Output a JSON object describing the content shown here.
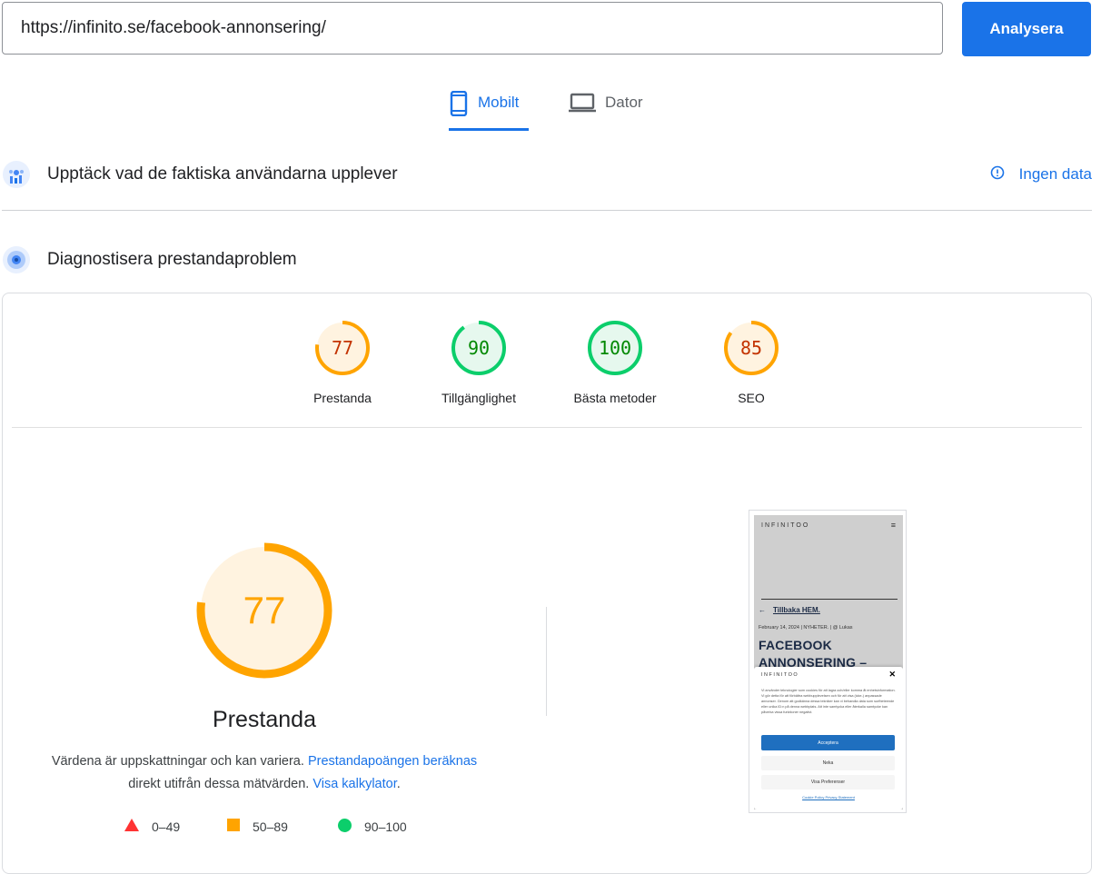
{
  "search": {
    "url": "https://infinito.se/facebook-annonsering/",
    "button_label": "Analysera"
  },
  "tabs": [
    {
      "label": "Mobilt",
      "icon": "smartphone-icon",
      "active": true
    },
    {
      "label": "Dator",
      "icon": "laptop-icon",
      "active": false
    }
  ],
  "field_data": {
    "title": "Upptäck vad de faktiska användarna upplever",
    "status": "Ingen data"
  },
  "lab": {
    "title": "Diagnostisera prestandaproblem"
  },
  "scores": [
    {
      "label": "Prestanda",
      "value": 77,
      "category": "average"
    },
    {
      "label": "Tillgänglighet",
      "value": 90,
      "category": "pass"
    },
    {
      "label": "Bästa metoder",
      "value": 100,
      "category": "pass"
    },
    {
      "label": "SEO",
      "value": 85,
      "category": "average"
    }
  ],
  "main_score": {
    "value": 77,
    "title": "Prestanda",
    "desc_1": "Värdena är uppskattningar och kan variera.",
    "link_1": "Prestandapoängen beräknas",
    "desc_2": "direkt utifrån dessa mätvärden.",
    "link_2": "Visa kalkylator",
    "desc_end": "."
  },
  "legend": [
    {
      "range": "0–49",
      "color": "#ff3333"
    },
    {
      "range": "50–89",
      "color": "#ffa400"
    },
    {
      "range": "90–100",
      "color": "#0cce6b"
    }
  ],
  "colors": {
    "accent": "#1a73e8",
    "average_stroke": "#ffa400",
    "average_fill": "#fff3e0",
    "average_text": "#c33300",
    "pass_stroke": "#0cce6b",
    "pass_fill": "#e6f8ee",
    "pass_text": "#008800"
  },
  "screenshot": {
    "logo": "INFINITOO",
    "back_label": "Tillbaka HEM.",
    "meta": "February 14, 2024 | NYHETER. | @ Lukas",
    "heading_1": "FACEBOOK",
    "heading_2": "ANNONSERING –",
    "cookie_logo": "INFINITOO",
    "cookie_text": "Vi använder teknologier som cookies för att lagra och/eller komma åt enhetsinformation. Vi gör detta för att förbättra webbupplevelsen och för att visa (icke-) anpassade annonser. Genom att godkänna dessa tekniker kan vi behandla data som surfbeteende eller unika ID:n på denna webbplats. Att inte samtycka eller återkalla samtycke kan påverka vissa funktioner negativt.",
    "accept": "Acceptera",
    "deny": "Neka",
    "prefs": "Visa Preferenser",
    "links": "Cookie Policy   Privacy Statement"
  }
}
